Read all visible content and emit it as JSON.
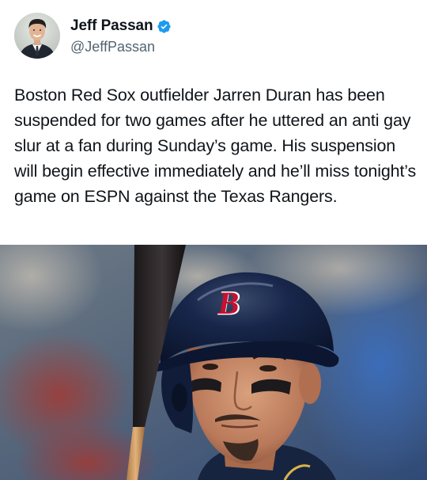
{
  "tweet": {
    "author": {
      "display_name": "Jeff Passan",
      "handle": "@JeffPassan",
      "verified": true,
      "verified_icon": "verified-badge-icon"
    },
    "text": "Boston Red Sox outfielder Jarren Duran has been suspended for two games after he uttered an anti gay slur at a fan during Sunday’s game. His suspension will begin effective immediately and he’ll miss tonight’s game on ESPN against the Texas Rangers.",
    "media": {
      "helmet_logo": "B"
    }
  },
  "colors": {
    "verified_blue": "#1d9bf0",
    "text_primary": "#0f1419",
    "text_secondary": "#536471",
    "helmet_navy": "#12213f",
    "logo_red": "#c8102e"
  }
}
